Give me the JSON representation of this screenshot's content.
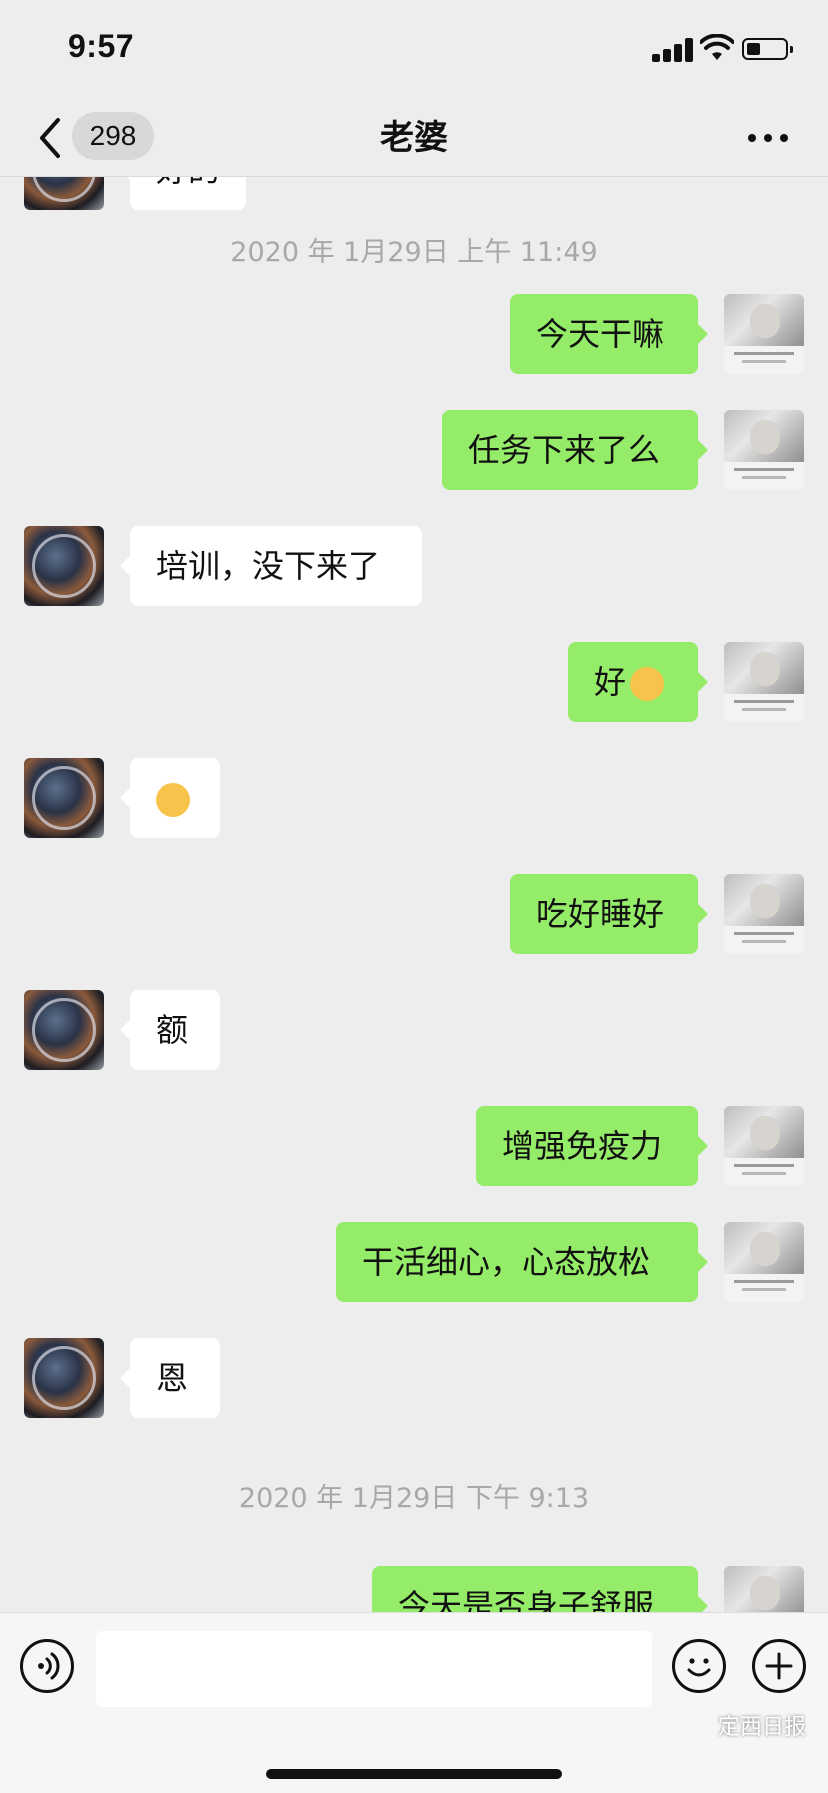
{
  "status_bar": {
    "time": "9:57"
  },
  "nav": {
    "unread_count": "298",
    "title": "老婆"
  },
  "messages": {
    "partial_top": "好的",
    "ts1": "2020 年 1月29日 上午 11:49",
    "m1": "今天干嘛",
    "m2": "任务下来了么",
    "m3": "培训，没下来了",
    "m4": "好",
    "m5": "吃好睡好",
    "m6": "额",
    "m7": "增强免疫力",
    "m8": "干活细心，心态放松",
    "m9": "恩",
    "ts2": "2020 年 1月29日 下午 9:13",
    "partial_bottom": "今天是否身子舒服"
  },
  "emoji": {
    "m4": "ok-hand-emoji",
    "m_her": "pleading-face-emoji"
  },
  "watermark": "定西日报",
  "colors": {
    "outgoing_bubble": "#95ec69",
    "incoming_bubble": "#ffffff",
    "background": "#ededed"
  }
}
